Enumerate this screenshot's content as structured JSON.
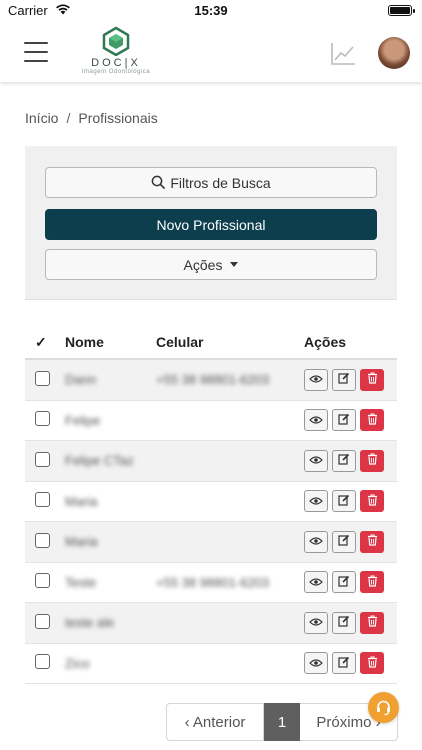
{
  "status_bar": {
    "carrier": "Carrier",
    "time": "15:39"
  },
  "header": {
    "brand": "DOC|X",
    "tagline": "Imagem Odontológica",
    "icons": [
      "menu-icon",
      "chart-line-icon",
      "avatar"
    ]
  },
  "breadcrumb": {
    "home": "Início",
    "separator": "/",
    "current": "Profissionais"
  },
  "filters": {
    "search_label": "Filtros de Busca",
    "new_label": "Novo Profissional",
    "actions_label": "Ações"
  },
  "table": {
    "headers": {
      "check": "✓",
      "nome": "Nome",
      "celular": "Celular",
      "acoes": "Ações"
    },
    "rows": [
      {
        "nome": "Dann",
        "celular": "+55 38 98801-6203"
      },
      {
        "nome": "Felipe",
        "celular": ""
      },
      {
        "nome": "Felipe CTaz",
        "celular": ""
      },
      {
        "nome": "Maria",
        "celular": ""
      },
      {
        "nome": "Maria",
        "celular": ""
      },
      {
        "nome": "Teste",
        "celular": "+55 38 98801-6203"
      },
      {
        "nome": "teste ale",
        "celular": ""
      },
      {
        "nome": "Zico",
        "celular": ""
      }
    ]
  },
  "pagination": {
    "prev": "‹ Anterior",
    "current": "1",
    "next": "Próximo ›"
  },
  "colors": {
    "primary": "#0d3e4e",
    "danger": "#dc3545",
    "support": "#f0a030",
    "logo": "#2f7a54"
  }
}
